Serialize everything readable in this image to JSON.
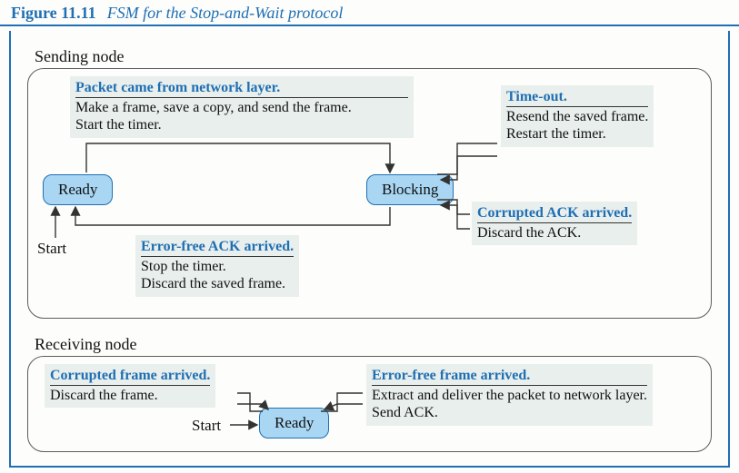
{
  "figure": {
    "number": "Figure 11.11",
    "title": "FSM for the Stop-and-Wait protocol"
  },
  "sending": {
    "label": "Sending node",
    "ready": "Ready",
    "blocking": "Blocking",
    "start": "Start",
    "ev_packet": {
      "title": "Packet came from network layer.",
      "line1": "Make a frame, save a copy, and send the frame.",
      "line2": "Start the timer."
    },
    "ev_timeout": {
      "title": "Time-out.",
      "line1": "Resend the saved frame.",
      "line2": "Restart the timer."
    },
    "ev_ack_ok": {
      "title": "Error-free ACK arrived.",
      "line1": "Stop the timer.",
      "line2": "Discard the saved frame."
    },
    "ev_ack_bad": {
      "title": "Corrupted ACK arrived.",
      "line1": "Discard the ACK."
    }
  },
  "receiving": {
    "label": "Receiving node",
    "ready": "Ready",
    "start": "Start",
    "ev_bad": {
      "title": "Corrupted frame arrived.",
      "line1": "Discard the frame."
    },
    "ev_ok": {
      "title": "Error-free frame arrived.",
      "line1": "Extract and deliver the packet to network layer.",
      "line2": "Send ACK."
    }
  }
}
